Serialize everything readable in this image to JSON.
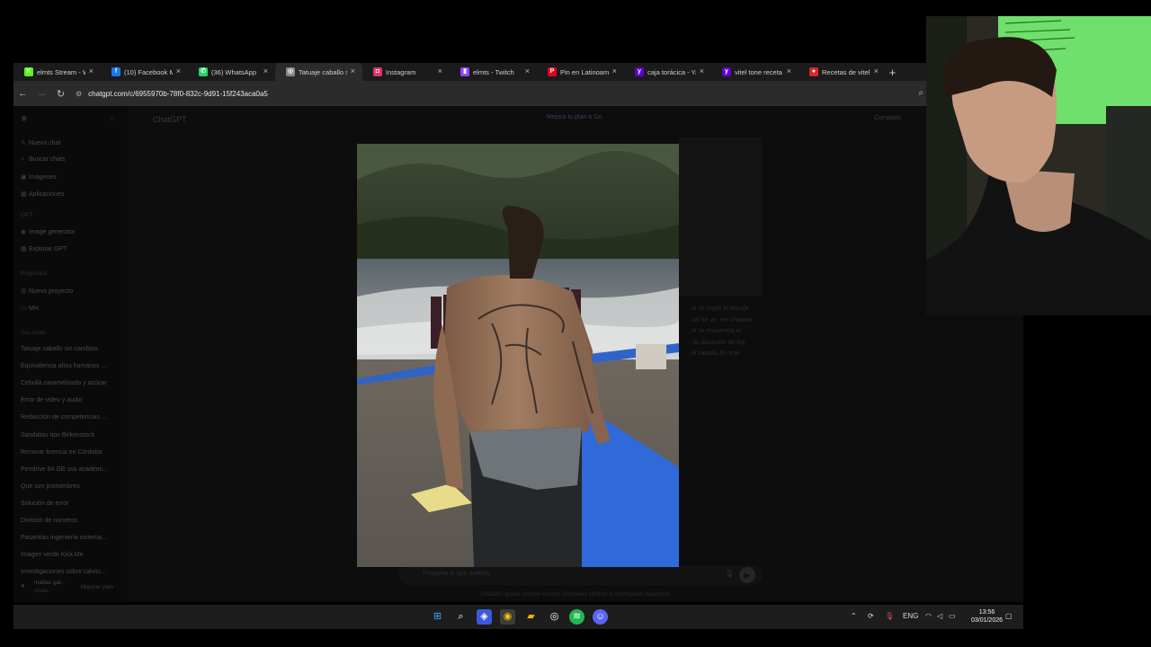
{
  "browser": {
    "tabs": [
      {
        "label": "elmts Stream - Wi",
        "icon": "kick-icon",
        "color": "#53fc18",
        "glyph": "K",
        "active": false
      },
      {
        "label": "(10) Facebook Ma",
        "icon": "facebook-icon",
        "color": "#1877f2",
        "glyph": "f",
        "active": false
      },
      {
        "label": "(36) WhatsApp",
        "icon": "whatsapp-icon",
        "color": "#25d366",
        "glyph": "✆",
        "active": false
      },
      {
        "label": "Tatuaje caballo si",
        "icon": "chatgpt-icon",
        "color": "#888888",
        "glyph": "◎",
        "active": true
      },
      {
        "label": "Instagram",
        "icon": "instagram-icon",
        "color": "#e1306c",
        "glyph": "◘",
        "active": false
      },
      {
        "label": "elmts - Twitch",
        "icon": "twitch-icon",
        "color": "#9146ff",
        "glyph": "▮",
        "active": false
      },
      {
        "label": "Pin en Latinoamé",
        "icon": "pinterest-icon",
        "color": "#e60023",
        "glyph": "P",
        "active": false
      },
      {
        "label": "caja torácica - Yah",
        "icon": "yahoo-icon",
        "color": "#6001d2",
        "glyph": "y",
        "active": false
      },
      {
        "label": "vitel tone receta",
        "icon": "yahoo-icon",
        "color": "#6001d2",
        "glyph": "y",
        "active": false
      },
      {
        "label": "Recetas de vitel tc",
        "icon": "recipe-site-icon",
        "color": "#d6262b",
        "glyph": "●",
        "active": false
      }
    ],
    "url": "chatgpt.com/c/6955970b-78f0-832c-9d91-15f243aca0a5"
  },
  "chatgpt": {
    "sidebar_items": [
      {
        "label": "Nuevo chat",
        "icon": "compose-icon",
        "glyph": "✎"
      },
      {
        "label": "Buscar chats",
        "icon": "search-icon",
        "glyph": "⌕"
      },
      {
        "label": "Imágenes",
        "icon": "images-icon",
        "glyph": "▣"
      },
      {
        "label": "Aplicaciones",
        "icon": "apps-icon",
        "glyph": "▦"
      }
    ],
    "gpt_head": "GPT",
    "gpt_items": [
      {
        "label": "Image generator",
        "icon": "image-generator-icon",
        "glyph": "◉"
      },
      {
        "label": "Explorar GPT",
        "icon": "explore-icon",
        "glyph": "▦"
      }
    ],
    "projects_head": "Proyectos",
    "project_items": [
      {
        "label": "Nuevo proyecto",
        "icon": "folder-plus-icon",
        "glyph": "⊞"
      },
      {
        "label": "MH",
        "icon": "folder-icon",
        "glyph": "▭"
      }
    ],
    "chats_head": "Tus chats",
    "chats": [
      "Tatuaje caballo sin cambios",
      "Equivalencia años humanos ...",
      "Cebolla caramelizada y azúcar",
      "Error de video y audio",
      "Redacción de competencias ...",
      "Sandalias tipo Birkenstock",
      "Renovar licencia en Córdoba",
      "Pendrive 64 GB uso académi...",
      "Que son pronombres",
      "Solución de error",
      "División de números",
      "Pasantías ingeniería sistema...",
      "Imagen verde Kick.Me",
      "Investigaciones sobre calvici..."
    ],
    "user_name": "matias gal...",
    "user_plan": "Gratis",
    "upgrade_sidebar": "Mejorar plan",
    "title": "ChatGPT",
    "upgrade_pill": "Mejora tu plan a Go",
    "share": "Compartir",
    "message_lines": [
      "...ai se copie el tatuaje",
      "...ual se ve, me importa",
      "...al se encuentra el",
      "... la ubicación de los",
      "...el caballo.En ese"
    ],
    "composer_placeholder": "Pregunta lo que quieras",
    "disclaimer": "ChatGPT puede cometer errores. Considera verificar la información importante."
  },
  "taskbar": {
    "lang": "ENG",
    "time": "13:56",
    "date": "03/01/2026"
  }
}
